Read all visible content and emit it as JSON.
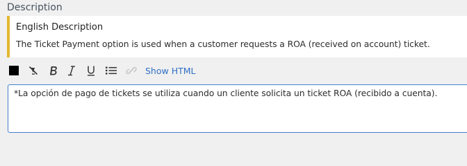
{
  "field": {
    "label": "Description"
  },
  "reference": {
    "title": "English Description",
    "text": "The Ticket Payment option is used when a customer requests a ROA (received on account) ticket.",
    "accent_color": "#e2b72f"
  },
  "toolbar": {
    "text_color": "#000000",
    "icons": {
      "text_color": "color-swatch",
      "clear_format": "clear-format-icon",
      "bold": "bold-icon",
      "italic": "italic-icon",
      "underline": "underline-icon",
      "bullet_list": "bullet-list-icon",
      "link": "link-icon"
    },
    "show_html_label": "Show HTML"
  },
  "editor": {
    "value": "*La opción de pago de tickets se utiliza cuando un cliente solicita un ticket ROA (recibido a cuenta).",
    "border_color": "#3f7fcf"
  }
}
